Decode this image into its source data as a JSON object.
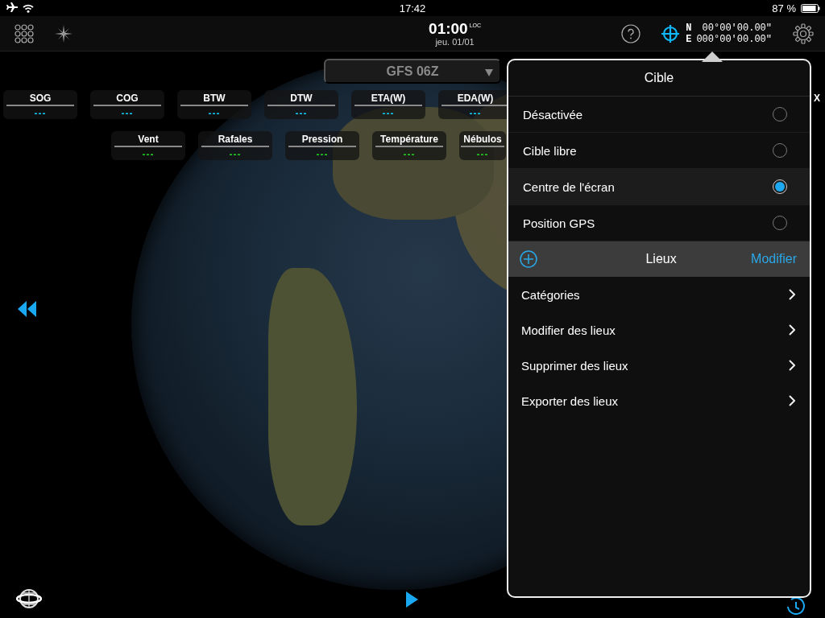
{
  "status_bar": {
    "time": "17:42",
    "battery": "87 %"
  },
  "toolbar": {
    "time": "01:00",
    "time_zone": "LOC",
    "date": "jeu. 01/01",
    "latitude_hemisphere": "N",
    "latitude": "00°00'00.00\"",
    "longitude_hemisphere": "E",
    "longitude": "000°00'00.00\""
  },
  "model_selector": {
    "value": "GFS 06Z"
  },
  "navigation_instruments": [
    {
      "label": "SOG",
      "value": "---"
    },
    {
      "label": "COG",
      "value": "---"
    },
    {
      "label": "BTW",
      "value": "---"
    },
    {
      "label": "DTW",
      "value": "---"
    },
    {
      "label": "ETA(W)",
      "value": "---"
    },
    {
      "label": "EDA(W)",
      "value": "---"
    }
  ],
  "edge_instrument": {
    "label": "X"
  },
  "weather_instruments": [
    {
      "label": "Vent",
      "value": "---"
    },
    {
      "label": "Rafales",
      "value": "---"
    },
    {
      "label": "Pression",
      "value": "---"
    },
    {
      "label": "Température",
      "value": "---"
    },
    {
      "label": "Nébulos",
      "value": "---"
    }
  ],
  "target_popover": {
    "title": "Cible",
    "options": [
      {
        "label": "Désactivée",
        "selected": false
      },
      {
        "label": "Cible libre",
        "selected": false
      },
      {
        "label": "Centre de l'écran",
        "selected": true
      },
      {
        "label": "Position GPS",
        "selected": false
      }
    ],
    "places": {
      "title": "Lieux",
      "action": "Modifier",
      "items": [
        "Catégories",
        "Modifier des lieux",
        "Supprimer des lieux",
        "Exporter des lieux"
      ]
    }
  }
}
